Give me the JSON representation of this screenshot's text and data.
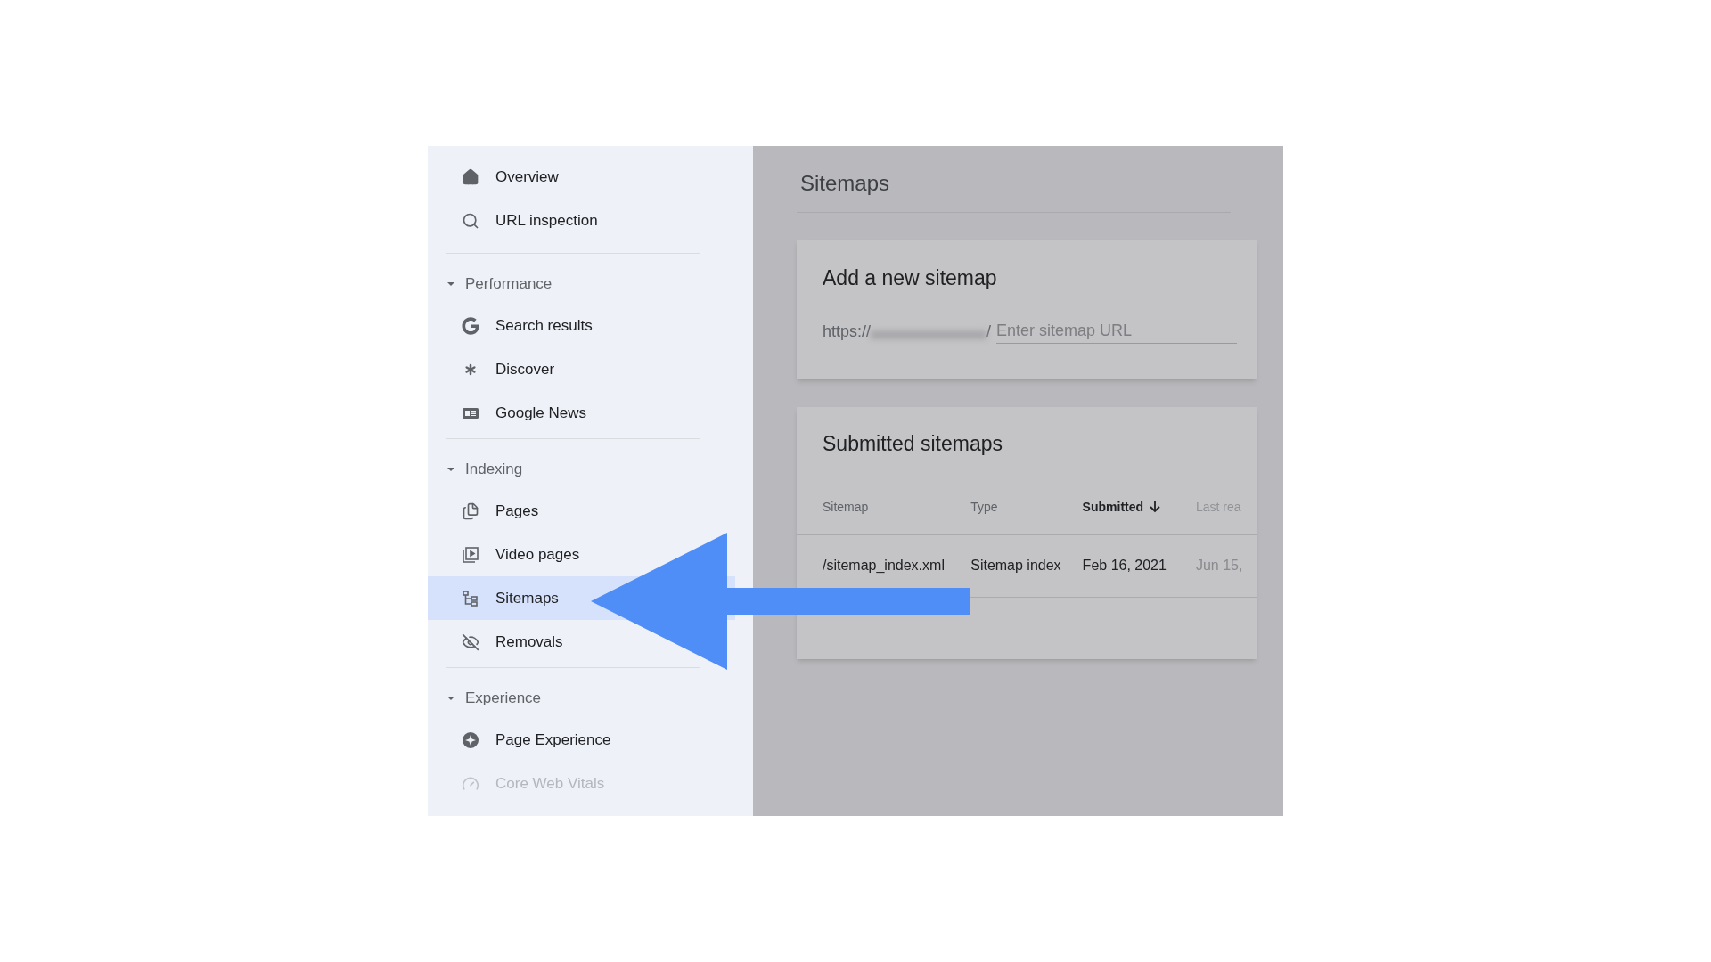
{
  "sidebar": {
    "sections": [
      {
        "items": [
          {
            "label": "Overview",
            "selected": false,
            "disabled": false
          },
          {
            "label": "URL inspection",
            "selected": false,
            "disabled": false
          }
        ]
      },
      {
        "title": "Performance",
        "expanded": true,
        "items": [
          {
            "label": "Search results",
            "selected": false,
            "disabled": false
          },
          {
            "label": "Discover",
            "selected": false,
            "disabled": false
          },
          {
            "label": "Google News",
            "selected": false,
            "disabled": false
          }
        ]
      },
      {
        "title": "Indexing",
        "expanded": true,
        "items": [
          {
            "label": "Pages",
            "selected": false,
            "disabled": false
          },
          {
            "label": "Video pages",
            "selected": false,
            "disabled": false
          },
          {
            "label": "Sitemaps",
            "selected": true,
            "disabled": false
          },
          {
            "label": "Removals",
            "selected": false,
            "disabled": false
          }
        ]
      },
      {
        "title": "Experience",
        "expanded": true,
        "items": [
          {
            "label": "Page Experience",
            "selected": false,
            "disabled": false
          },
          {
            "label": "Core Web Vitals",
            "selected": false,
            "disabled": true
          }
        ]
      }
    ]
  },
  "main": {
    "title": "Sitemaps",
    "add_card": {
      "title": "Add a new sitemap",
      "prefix": "https://",
      "suffix": "/",
      "placeholder": "Enter sitemap URL"
    },
    "submitted_card": {
      "title": "Submitted sitemaps",
      "columns": [
        {
          "label": "Sitemap",
          "sorted": false
        },
        {
          "label": "Type",
          "sorted": false
        },
        {
          "label": "Submitted",
          "sorted": true
        },
        {
          "label": "Last rea",
          "sorted": false
        }
      ],
      "rows": [
        {
          "cells": [
            "/sitemap_index.xml",
            "Sitemap index",
            "Feb 16, 2021",
            "Jun 15,"
          ]
        }
      ]
    }
  }
}
